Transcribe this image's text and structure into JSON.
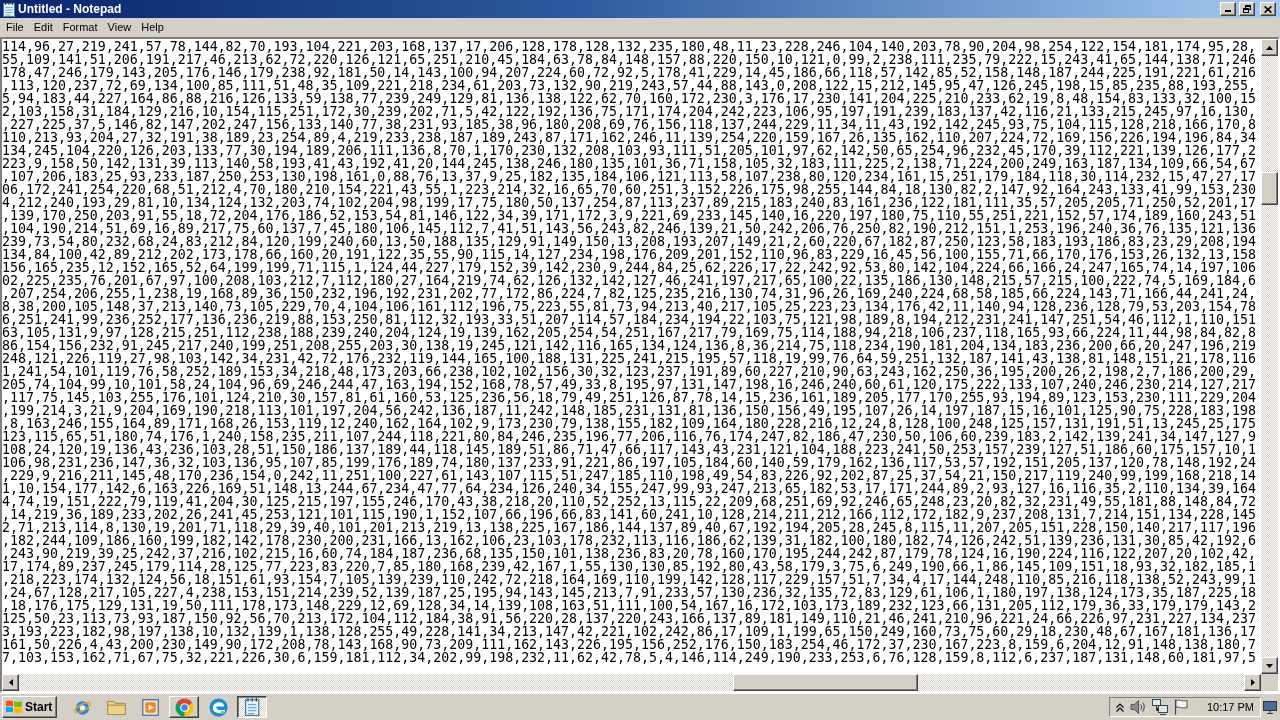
{
  "window": {
    "title": "Untitled - Notepad"
  },
  "menu": [
    "File",
    "Edit",
    "Format",
    "View",
    "Help"
  ],
  "editor": {
    "lines": [
      "114,96,27,219,241,57,78,144,82,70,193,104,221,203,168,137,17,206,128,178,128,132,235,180,48,11,23,228,246,104,140,203,78,90,204,98,254,122,154,181,174,95,28,",
      "55,109,141,51,206,191,217,46,213,62,72,220,126,121,65,251,210,45,184,63,78,84,148,157,88,220,150,10,121,0,99,2,238,111,235,79,222,15,243,41,65,144,138,71,246",
      "178,47,246,179,143,205,176,146,179,238,92,181,50,14,143,100,94,207,224,60,72,92,5,178,41,229,14,45,186,66,118,57,142,85,52,158,148,187,244,225,191,221,61,216",
      ",113,120,237,72,69,134,100,85,111,51,48,35,109,221,218,234,61,203,73,132,90,219,243,57,44,88,143,0,208,122,15,212,145,95,47,126,245,198,15,85,235,88,193,255,",
      "5,94,183,44,227,164,86,88,216,126,133,59,138,77,239,249,129,81,136,138,122,62,70,160,172,230,3,176,17,230,141,204,225,210,233,62,19,8,48,154,83,133,32,100,15",
      "2,103,158,31,184,129,216,10,154,115,251,172,30,239,202,71,5,42,122,192,136,75,171,174,204,242,223,106,95,197,191,239,183,137,42,116,21,133,215,245,97,16,130,",
      ",227,225,37,5,146,82,147,202,247,156,133,140,77,38,231,93,185,38,96,180,208,69,76,156,118,137,244,229,11,34,11,43,192,142,245,93,75,104,115,128,218,166,170,8",
      "110,213,93,204,27,32,191,38,189,23,254,89,4,219,233,238,187,189,243,87,171,162,246,11,139,254,220,159,167,26,135,162,110,207,224,72,169,156,226,194,196,84,34",
      "134,245,104,220,126,203,133,77,30,194,189,206,111,136,8,70,1,170,230,132,208,103,93,111,51,205,101,97,62,142,50,65,254,96,232,45,170,39,112,221,139,126,177,2",
      "223,9,158,50,142,131,39,113,140,58,193,41,43,192,41,20,144,245,138,246,180,135,101,36,71,158,105,32,183,111,225,2,138,71,224,200,249,163,187,134,109,66,54,67",
      ",107,206,183,25,93,233,187,250,253,130,198,161,0,88,76,13,37,9,25,182,135,184,106,121,113,58,107,238,80,120,234,161,15,251,179,184,118,30,114,232,15,47,27,17",
      "06,172,241,254,220,68,51,212,4,70,180,210,154,221,43,55,1,223,214,32,16,65,70,60,251,3,152,226,175,98,255,144,84,18,130,82,2,147,92,164,243,133,41,99,153,230",
      "4,212,240,193,29,81,10,134,124,132,203,74,102,204,98,199,17,75,180,50,137,254,87,113,237,89,215,183,240,83,161,236,122,181,111,35,57,205,205,71,250,52,201,17",
      ",139,170,250,203,91,55,18,72,204,176,186,52,153,54,81,146,122,34,39,171,172,3,9,221,69,233,145,140,16,220,197,180,75,110,55,251,221,152,57,174,189,160,243,51",
      ",104,190,214,51,69,16,89,217,75,60,137,7,45,180,106,145,112,7,41,51,143,56,243,82,246,139,21,50,242,206,76,250,82,190,212,151,1,253,196,240,36,76,135,121,136",
      "239,73,54,80,232,68,24,83,212,84,120,199,240,60,13,50,188,135,129,91,149,150,13,208,193,207,149,21,2,60,220,67,182,87,250,123,58,183,193,186,83,23,29,208,194",
      "134,84,100,42,89,212,202,173,178,66,160,20,191,122,35,55,90,115,14,127,234,198,176,209,201,152,110,96,83,229,16,45,56,100,155,71,66,170,176,153,26,132,13,158",
      "156,165,235,12,152,165,52,64,199,199,71,115,1,124,44,227,179,152,39,142,230,9,244,84,25,62,226,17,22,242,92,53,80,142,104,224,66,166,24,247,165,74,14,197,106",
      "02,225,235,76,201,67,97,100,208,103,212,7,112,180,27,164,219,74,62,126,132,142,127,46,241,197,217,65,100,22,135,186,130,148,215,57,215,100,222,74,5,169,184,6",
      ",207,254,206,255,1,238,19,168,89,36,150,232,196,192,231,202,77,172,86,224,7,82,125,235,216,130,74,31,96,26,169,240,224,68,58,185,66,224,143,71,166,44,241,24,",
      "8,38,200,105,148,37,213,140,73,105,229,70,4,104,106,161,112,196,75,223,55,81,73,94,213,40,217,105,25,223,23,134,176,42,11,140,94,128,236,128,79,53,203,154,78",
      "6,251,241,99,236,252,177,136,236,219,88,153,250,81,112,32,193,33,51,207,114,57,184,234,194,22,103,75,121,98,189,8,194,212,231,241,147,251,54,46,112,1,110,151",
      "63,105,131,9,97,128,215,251,112,238,188,239,240,204,124,19,139,162,205,254,54,251,167,217,79,169,75,114,188,94,218,106,237,118,165,93,66,224,11,44,98,84,82,8",
      "86,154,156,232,91,245,217,240,199,251,208,255,203,30,138,19,245,121,142,116,165,134,124,136,8,36,214,75,118,234,190,181,204,134,183,236,200,66,20,247,196,219",
      "248,121,226,119,27,98,103,142,34,231,42,72,176,232,119,144,165,100,188,131,225,241,215,195,57,118,19,99,76,64,59,251,132,187,141,43,138,81,148,151,21,178,116",
      "1,241,54,101,119,76,58,252,189,153,34,218,48,173,203,66,238,102,102,156,30,32,123,237,191,89,60,227,210,90,63,243,162,250,36,195,200,26,2,198,2,7,186,200,29,",
      "205,74,104,99,10,101,58,24,104,96,69,246,244,47,163,194,152,168,78,57,49,33,8,195,97,131,147,198,16,246,240,60,61,120,175,222,133,107,240,246,230,214,127,217",
      ",117,75,145,103,255,176,101,124,210,30,157,81,61,160,53,125,236,56,18,79,49,251,126,87,78,14,15,236,161,189,205,177,170,255,93,194,89,123,153,230,111,229,204",
      ",199,214,3,21,9,204,169,190,218,113,101,197,204,56,242,136,187,11,242,148,185,231,131,81,136,150,156,49,195,107,26,14,197,187,15,16,101,125,90,75,228,183,198",
      ",8,163,246,155,164,89,171,168,26,153,119,12,240,162,164,102,9,173,230,79,138,155,182,109,164,180,228,216,12,24,8,128,100,248,125,157,131,191,51,13,245,25,175",
      "123,115,65,51,180,74,176,1,240,158,235,211,107,244,118,221,80,84,246,235,196,77,206,116,76,174,247,82,186,47,230,50,106,60,239,183,2,142,139,241,34,147,127,9",
      "108,24,120,19,136,43,236,103,28,51,150,186,137,189,44,118,145,189,51,86,71,47,66,117,143,43,231,121,104,188,223,241,50,253,157,239,127,51,186,60,175,157,10,1",
      "106,98,231,236,147,36,32,103,136,95,107,85,199,176,189,74,180,137,233,91,221,86,197,105,184,60,140,59,179,162,136,117,53,57,192,151,205,137,120,78,148,192,24",
      ",229,9,216,211,145,48,170,236,154,0,242,11,251,100,227,61,143,107,115,51,247,185,110,198,49,54,83,226,92,202,87,25,37,54,21,150,217,119,240,99,199,168,218,14",
      "1,10,154,177,142,6,163,226,169,51,148,13,244,67,234,47,77,64,234,126,240,34,155,247,99,93,247,213,65,182,53,17,171,244,89,2,93,127,16,116,35,2,110,134,39,164",
      "4,74,19,151,222,79,119,41,204,30,125,215,197,155,246,170,43,38,218,20,110,52,252,13,115,22,209,68,251,69,92,246,65,248,23,20,82,32,231,49,55,181,88,148,84,72",
      ",14,219,36,189,233,202,26,241,45,253,121,101,115,190,1,152,107,66,196,66,83,141,60,241,10,128,214,211,212,166,112,172,182,9,237,208,131,7,214,151,134,228,145",
      "2,71,213,114,8,130,19,201,71,118,29,39,40,101,201,213,219,13,138,225,167,186,144,137,89,40,67,192,194,205,28,245,8,115,11,207,205,151,228,150,140,217,117,196",
      ",182,244,109,186,160,199,182,142,178,230,200,231,166,13,162,106,23,103,178,232,113,116,186,62,139,31,182,100,180,182,74,126,242,51,139,236,131,30,85,42,192,6",
      ",243,90,219,39,25,242,37,216,102,215,16,60,74,184,187,236,68,135,150,101,138,236,83,20,78,160,170,195,244,242,87,179,78,124,16,190,224,116,122,207,20,102,42,",
      "17,174,89,237,245,179,114,28,125,77,223,83,220,7,85,180,168,239,42,167,1,55,130,130,85,192,80,43,58,179,3,75,6,249,190,66,1,86,145,109,151,18,93,32,182,185,1",
      ",218,223,174,132,124,56,18,151,61,93,154,7,105,139,239,110,242,72,218,164,169,110,199,142,128,117,229,157,51,7,34,4,17,144,248,110,85,216,118,138,52,243,99,1",
      ",24,67,128,217,105,227,4,238,153,151,214,239,52,139,187,25,195,94,143,145,213,7,91,233,57,130,236,32,135,72,83,129,61,106,1,180,197,138,124,173,35,187,225,18",
      ",18,176,175,129,131,19,50,111,178,173,148,229,12,69,128,34,14,139,108,163,51,111,100,54,167,16,172,103,173,189,232,123,66,131,205,112,179,36,33,179,179,143,2",
      "125,50,23,113,73,93,187,150,92,56,70,213,172,104,112,184,38,91,56,220,28,137,220,243,166,137,89,181,149,110,21,46,241,210,96,221,24,66,226,97,231,227,134,237",
      "3,193,223,182,98,197,138,10,132,139,1,138,128,255,49,228,141,34,213,147,42,221,102,242,86,17,109,1,199,65,150,249,160,73,75,60,29,18,230,48,67,167,181,136,17",
      "161,50,226,4,43,200,230,149,90,172,208,78,143,168,90,73,209,111,162,143,226,195,156,252,176,150,183,254,46,172,37,230,167,223,8,159,6,204,12,91,148,138,180,7",
      "7,103,153,162,71,67,75,32,221,226,30,6,159,181,112,34,202,99,198,232,11,62,42,78,5,4,146,114,249,190,233,253,6,76,128,159,8,112,6,237,187,131,148,60,181,97,5"
    ]
  },
  "taskbar": {
    "start": "Start",
    "apps": [
      {
        "kind": "globe",
        "open": false,
        "selected": false
      },
      {
        "kind": "folder",
        "open": false,
        "selected": false
      },
      {
        "kind": "player",
        "open": false,
        "selected": false
      },
      {
        "kind": "wheel",
        "open": true,
        "selected": false
      },
      {
        "kind": "swirl",
        "open": false,
        "selected": false
      },
      {
        "kind": "notepad",
        "open": true,
        "selected": true
      }
    ],
    "clock": "10:17 PM"
  }
}
